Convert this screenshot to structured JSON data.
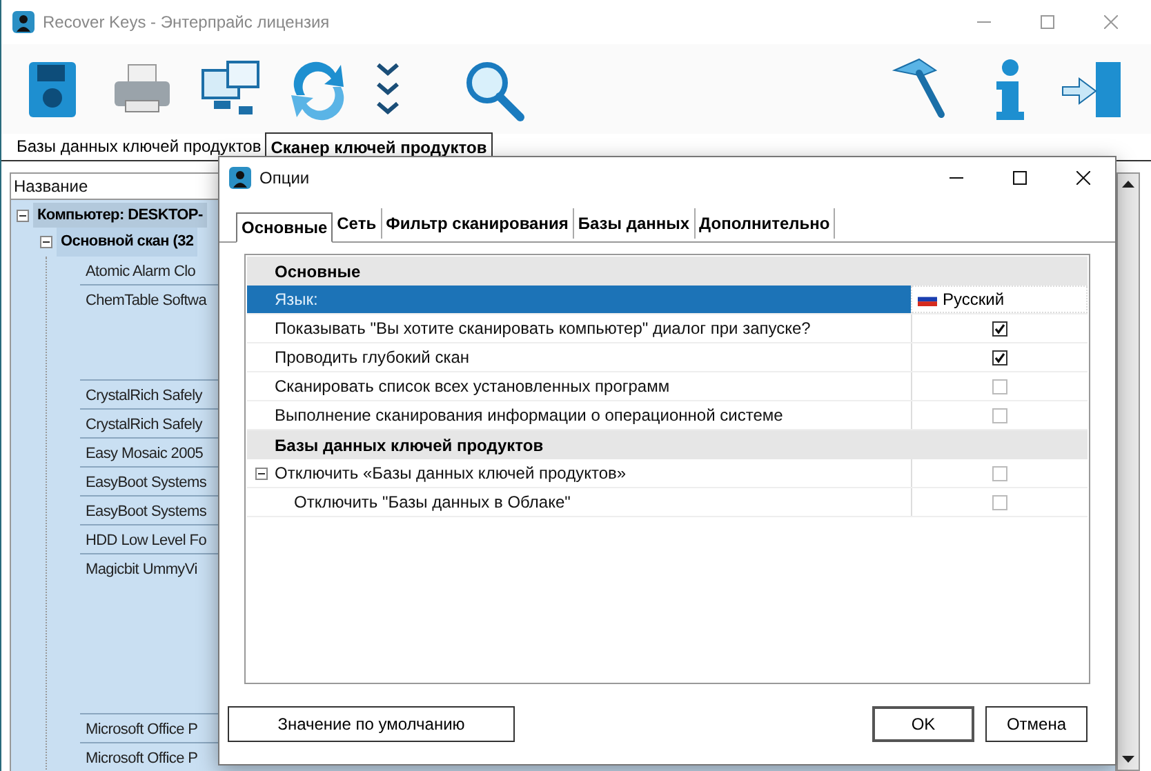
{
  "window": {
    "title": "Recover Keys - Энтерпрайс лицензия"
  },
  "tabs": [
    {
      "label": "Базы данных ключей продуктов",
      "selected": false
    },
    {
      "label": "Сканер ключей продуктов",
      "selected": true
    }
  ],
  "tree": {
    "column": "Название",
    "root": {
      "label": "Компьютер: DESKTOP-",
      "expanded": true,
      "children": [
        {
          "label": "Основной скан (32",
          "expanded": true,
          "children": [
            {
              "label": "Atomic Alarm Clo"
            },
            {
              "label": "ChemTable Softwa"
            },
            {
              "label": "CrystalRich Safely"
            },
            {
              "label": "CrystalRich Safely"
            },
            {
              "label": "Easy Mosaic 2005"
            },
            {
              "label": "EasyBoot Systems"
            },
            {
              "label": "EasyBoot Systems"
            },
            {
              "label": "HDD Low Level Fo"
            },
            {
              "label": "Magicbit UmmyVi"
            },
            {
              "label": "Microsoft Office P"
            },
            {
              "label": "Microsoft Office P"
            }
          ]
        }
      ]
    }
  },
  "dialog": {
    "title": "Опции",
    "tabs": [
      {
        "label": "Основные",
        "selected": true
      },
      {
        "label": "Сеть",
        "selected": false
      },
      {
        "label": "Фильтр сканирования",
        "selected": false
      },
      {
        "label": "Базы данных",
        "selected": false
      },
      {
        "label": "Дополнительно",
        "selected": false
      }
    ],
    "sections": [
      {
        "title": "Основные",
        "rows": [
          {
            "kind": "select",
            "label": "Язык:",
            "value": "Русский",
            "selected": true
          },
          {
            "kind": "check",
            "label": "Показывать \"Вы хотите сканировать компьютер\" диалог при запуске?",
            "checked": true,
            "selected": false
          },
          {
            "kind": "check",
            "label": "Проводить глубокий скан",
            "checked": true,
            "selected": false
          },
          {
            "kind": "check",
            "label": "Сканировать список всех установленных программ",
            "checked": false,
            "selected": false
          },
          {
            "kind": "check",
            "label": "Выполнение сканирования информации о операционной системе",
            "checked": false,
            "selected": false
          }
        ]
      },
      {
        "title": "Базы данных ключей продуктов",
        "rows": [
          {
            "kind": "check",
            "label": "Отключить «Базы данных ключей продуктов»",
            "checked": false,
            "selected": false,
            "expanded": true,
            "children": [
              {
                "kind": "check",
                "label": "Отключить \"Базы данных в Облаке\"",
                "checked": false,
                "selected": false
              }
            ]
          }
        ]
      }
    ],
    "buttons": {
      "default": "Значение по умолчанию",
      "ok": "OK",
      "cancel": "Отмена"
    }
  }
}
